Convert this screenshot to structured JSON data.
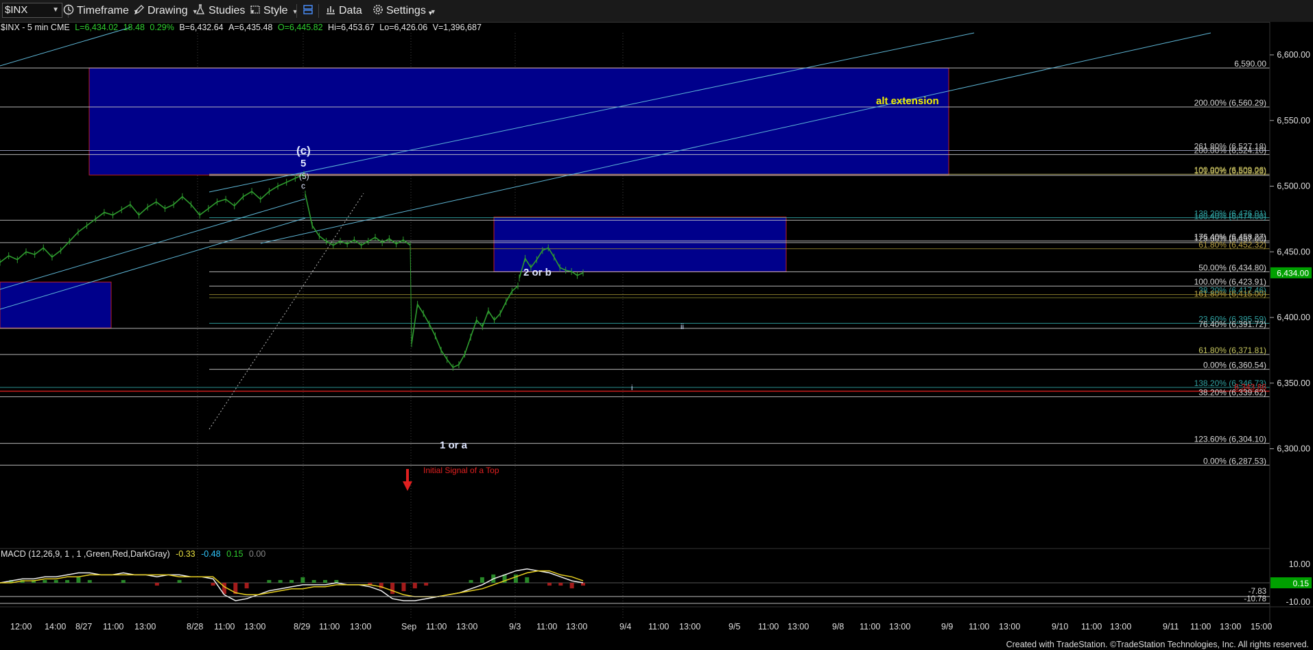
{
  "toolbar": {
    "symbol": "$INX",
    "timeframe": "Timeframe",
    "drawing": "Drawing",
    "studies": "Studies",
    "style": "Style",
    "data": "Data",
    "settings": "Settings"
  },
  "header": {
    "name": "$INX - 5 min  CME",
    "last": "L=6,434.02",
    "chg": "18.48",
    "pct": "0.29%",
    "bid": "B=6,432.64",
    "ask": "A=6,435.48",
    "open": "O=6,445.82",
    "high": "Hi=6,453.67",
    "low": "Lo=6,426.06",
    "vol": "V=1,396,687"
  },
  "macd": {
    "label": "MACD (12,26,9, 1 , 1 ,Green,Red,DarkGray)",
    "v1": "-0.33",
    "v2": "-0.48",
    "v3": "0.15",
    "v4": "0.00"
  },
  "footer": "Created with TradeStation. ©TradeStation Technologies, Inc. All rights reserved.",
  "colors": {
    "up": "#2f9e2f",
    "zone": "#00008b",
    "fib": "#c8c8c8",
    "red": "#e02020",
    "accent": "#00a000"
  },
  "chart_data": {
    "type": "line",
    "title": "$INX - 5 min",
    "price_axis": {
      "ylim": [
        6272,
        6610
      ],
      "ticks": [
        6300,
        6350,
        6400,
        6450,
        6500,
        6550,
        6600
      ],
      "tick_labels": [
        "6,300.00",
        "6,350.00",
        "6,400.00",
        "6,450.00",
        "6,500.00",
        "6,550.00",
        "6,600.00"
      ],
      "current": "6,434.00"
    },
    "time_labels": [
      "12:00",
      "14:00",
      "8/27",
      "11:00",
      "13:00",
      "8/28",
      "11:00",
      "13:00",
      "8/29",
      "11:00",
      "13:00",
      "Sep",
      "11:00",
      "13:00",
      "9/3",
      "11:00",
      "13:00",
      "9/4",
      "11:00",
      "13:00",
      "9/5",
      "11:00",
      "13:00",
      "9/8",
      "11:00",
      "13:00",
      "9/9",
      "11:00",
      "13:00",
      "9/10",
      "11:00",
      "13:00",
      "9/11",
      "11:00",
      "13:00",
      "15:00"
    ],
    "series": [
      {
        "name": "$INX",
        "y": [
          6442,
          6447,
          6444,
          6450,
          6448,
          6453,
          6446,
          6451,
          6458,
          6465,
          6470,
          6475,
          6480,
          6478,
          6482,
          6486,
          6478,
          6484,
          6488,
          6483,
          6486,
          6492,
          6486,
          6478,
          6483,
          6488,
          6490,
          6485,
          6492,
          6496,
          6490,
          6496,
          6500,
          6503,
          6506,
          6509,
          6494,
          6470,
          6462,
          6458,
          6455,
          6458,
          6456,
          6459,
          6455,
          6458,
          6461,
          6457,
          6460,
          6456,
          6459,
          6455,
          6380,
          6410,
          6403,
          6395,
          6386,
          6375,
          6368,
          6362,
          6364,
          6372,
          6385,
          6398,
          6393,
          6405,
          6398,
          6403,
          6412,
          6420,
          6424,
          6430,
          6445,
          6438,
          6444,
          6451,
          6453,
          6446,
          6438,
          6436,
          6435,
          6432,
          6434
        ]
      }
    ],
    "waves": [
      {
        "label": "(c)"
      },
      {
        "label": "5"
      },
      {
        "label": "(5)"
      },
      {
        "label": "c"
      },
      {
        "label": "2 or b"
      },
      {
        "label": "1 or a"
      },
      {
        "label": "ii"
      },
      {
        "label": "i"
      },
      {
        "label": "alt extension"
      },
      {
        "label": "Initial Signal of a Top"
      }
    ],
    "fib_levels": [
      {
        "text": "6,590.00",
        "price": 6590
      },
      {
        "text": "200.00% (6,560.29)",
        "price": 6560.29
      },
      {
        "text": "261.80% (6,527.18)",
        "price": 6527.18
      },
      {
        "text": "200.00% (6,524.10)",
        "price": 6524.1
      },
      {
        "text": "100.00% (6,509.06)",
        "price": 6509.06
      },
      {
        "text": "101.80% (6,508.23)",
        "price": 6508.23
      },
      {
        "text": "138.20% (6,476.01)",
        "price": 6476.01
      },
      {
        "text": "160.40% (6,474.00)",
        "price": 6474
      },
      {
        "text": "176.40% (6,458.27)",
        "price": 6458.27
      },
      {
        "text": "123.60% (6,457.00)",
        "price": 6457
      },
      {
        "text": "61.80% (6,452.32)",
        "price": 6452.32
      },
      {
        "text": "50.00% (6,434.80)",
        "price": 6434.8
      },
      {
        "text": "100.00% (6,423.91)",
        "price": 6423.91
      },
      {
        "text": "38.20% (6,417.46)",
        "price": 6417.46
      },
      {
        "text": "161.80% (6,415.00)",
        "price": 6415
      },
      {
        "text": "23.60% (6,395.59)",
        "price": 6395.59
      },
      {
        "text": "76.40% (6,391.72)",
        "price": 6391.72
      },
      {
        "text": "61.80% (6,371.81)",
        "price": 6371.81
      },
      {
        "text": "0.00% (6,360.54)",
        "price": 6360.54
      },
      {
        "text": "138.20% (6,346.73)",
        "price": 6346.73
      },
      {
        "text": "6,343.86",
        "price": 6343.86
      },
      {
        "text": "38.20% (6,339.62)",
        "price": 6339.62
      },
      {
        "text": "123.60% (6,304.10)",
        "price": 6304.1
      },
      {
        "text": "0.00% (6,287.53)",
        "price": 6287.53
      }
    ],
    "macd_axis": {
      "ticks": [
        "10.00",
        "-10.00"
      ],
      "right_labels": [
        "0.15",
        "-7.83",
        "-10.78"
      ]
    }
  }
}
